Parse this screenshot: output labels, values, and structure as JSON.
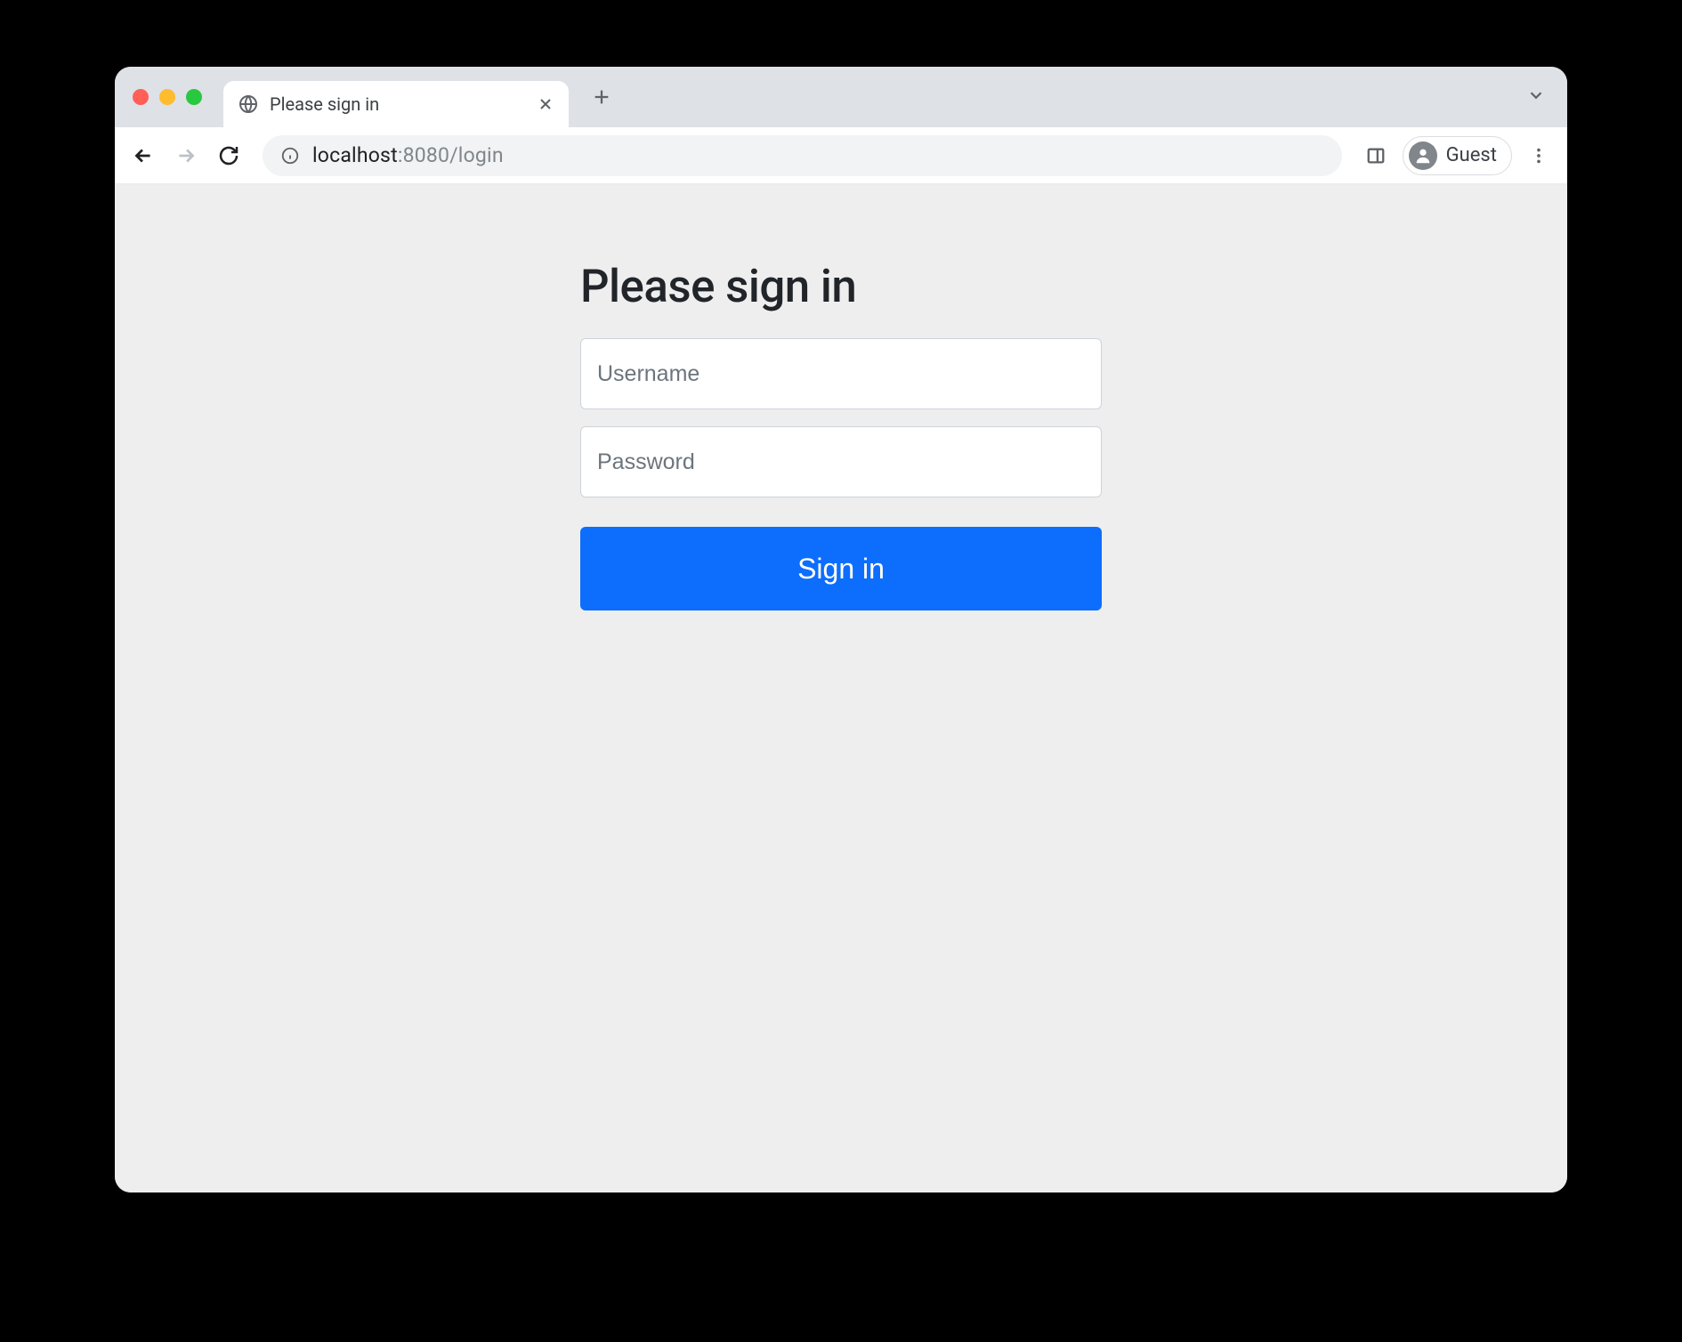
{
  "browser": {
    "tab": {
      "title": "Please sign in"
    },
    "address": {
      "host": "localhost",
      "port_path": ":8080/login"
    },
    "profile": {
      "label": "Guest"
    }
  },
  "page": {
    "heading": "Please sign in",
    "username": {
      "placeholder": "Username",
      "value": ""
    },
    "password": {
      "placeholder": "Password",
      "value": ""
    },
    "submit_label": "Sign in"
  }
}
